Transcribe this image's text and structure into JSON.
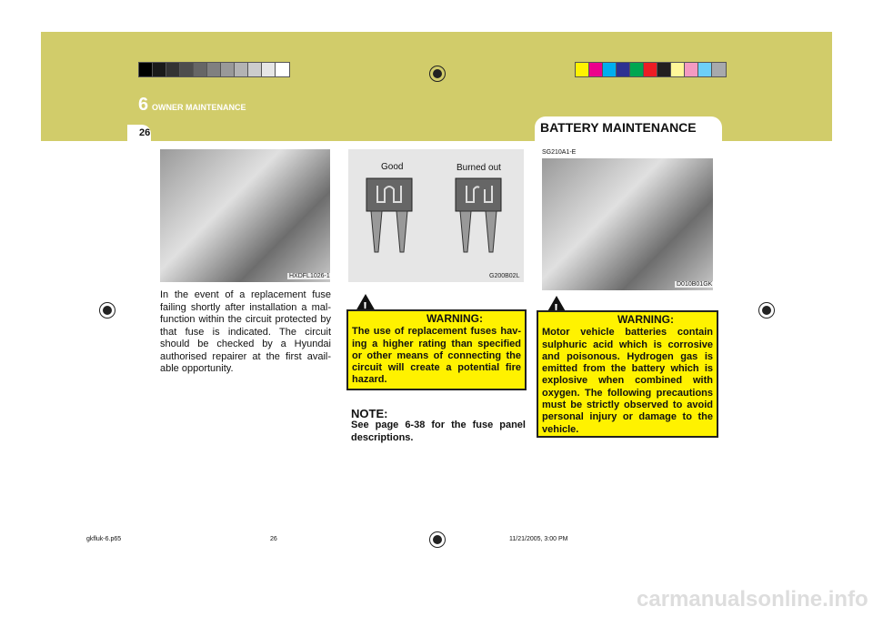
{
  "header": {
    "chapter_number": "6",
    "chapter_title": "OWNER MAINTENANCE",
    "page_number": "26",
    "section_title": "BATTERY MAINTENANCE"
  },
  "gray_swatches": [
    "#000000",
    "#1a1a1a",
    "#333333",
    "#4d4d4d",
    "#666666",
    "#808080",
    "#999999",
    "#b3b3b3",
    "#cccccc",
    "#e6e6e6",
    "#ffffff"
  ],
  "color_swatches": [
    "#fff200",
    "#ec008c",
    "#00aeef",
    "#2e3192",
    "#00a651",
    "#ed1c24",
    "#231f20",
    "#fff799",
    "#f49ac1",
    "#6dcff6",
    "#a7a9ac"
  ],
  "band_color": "#d1cc6a",
  "left": {
    "image_code": "HXDFL1026-1",
    "text": "In the event of a replacement fuse failing shortly after installation a mal-function within the circuit protected by that fuse is indicated. The circuit should be checked by a Hyundai authorised repairer at the first avail-able opportunity."
  },
  "middle": {
    "fuse_good_label": "Good",
    "fuse_burned_label": "Burned out",
    "image_code": "G200B02L",
    "warning": {
      "title": "WARNING:",
      "text": "The use of replacement fuses hav-ing a higher rating than specified or other means of connecting the circuit will create a potential fire hazard."
    },
    "note": {
      "title": "NOTE:",
      "text": "See page 6-38 for the fuse panel descriptions."
    }
  },
  "right": {
    "section_code": "SG210A1-E",
    "image_code": "D010B01GK",
    "warning": {
      "title": "WARNING:",
      "text": "Motor vehicle batteries contain sulphuric acid which is corrosive and poisonous. Hydrogen gas is emitted from the battery which is explosive when combined with oxygen. The following precautions must be strictly observed to avoid personal injury or damage to the vehicle."
    }
  },
  "footer": {
    "file": "gkfluk-6.p65",
    "page": "26",
    "date": "11/21/2005, 3:00 PM"
  },
  "watermark": "carmanualsonline.info"
}
